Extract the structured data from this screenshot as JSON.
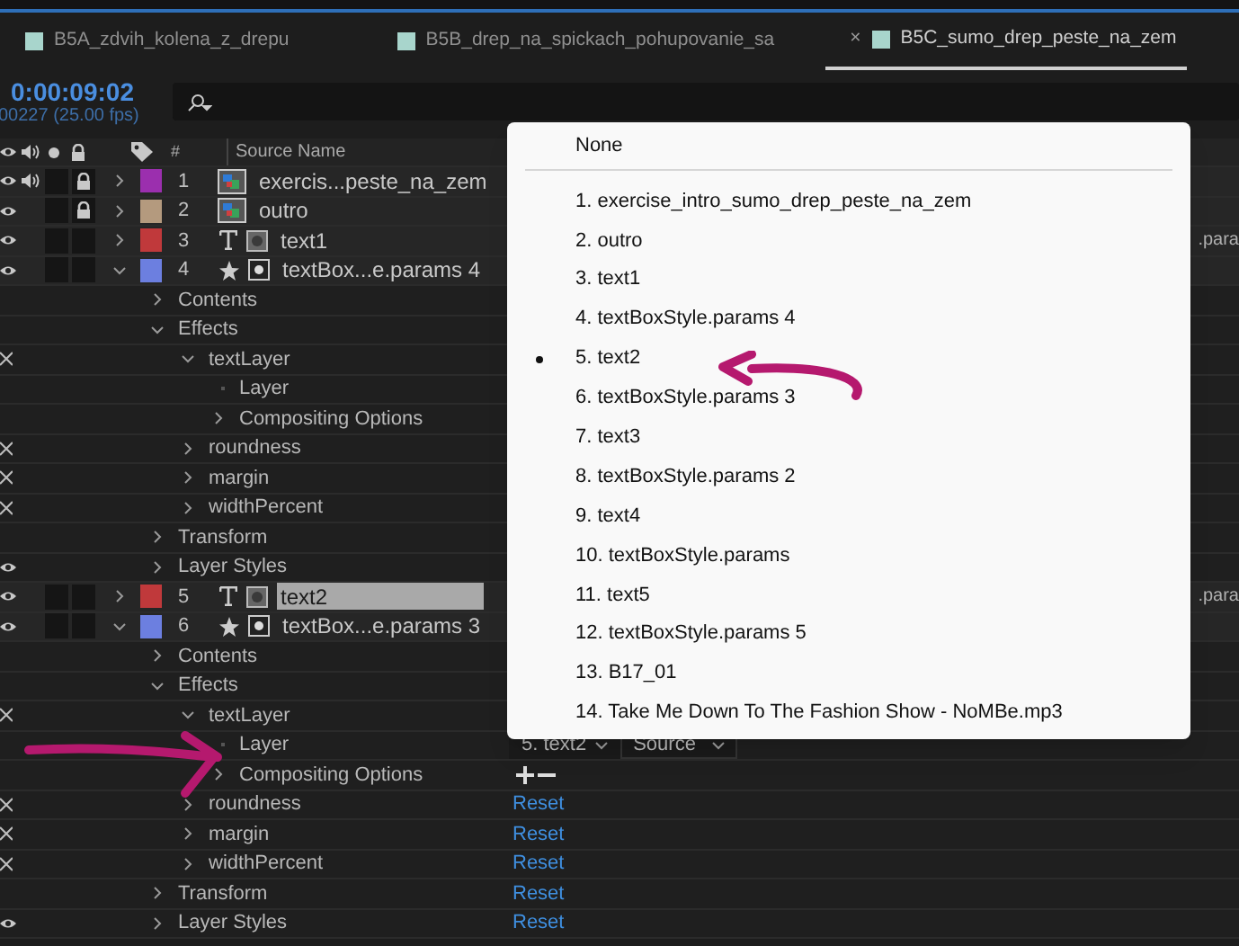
{
  "tabs": [
    {
      "label": "B5A_zdvih_kolena_z_drepu",
      "selected": false
    },
    {
      "label": "B5B_drep_na_spickach_pohupovanie_sa",
      "selected": false
    },
    {
      "label": "B5C_sumo_drep_peste_na_zem",
      "selected": true,
      "close": "×"
    }
  ],
  "timecode": "0:00:09:02",
  "frame_info": "00227 (25.00 fps)",
  "columns": {
    "number": "#",
    "source_name": "Source Name"
  },
  "layers": [
    {
      "number": "1",
      "name": "exercis...peste_na_zem",
      "color": "#9b2fae",
      "kind": "footage",
      "eye": true,
      "audio": true,
      "solo": false,
      "lock": true,
      "expanded": false,
      "selected": false
    },
    {
      "number": "2",
      "name": "outro",
      "color": "#b49a7e",
      "kind": "footage",
      "eye": true,
      "audio": false,
      "solo": false,
      "lock": true,
      "expanded": false,
      "selected": false
    },
    {
      "number": "3",
      "name": "text1",
      "color": "#c0393b",
      "kind": "text",
      "eye": true,
      "audio": false,
      "solo": false,
      "lock": false,
      "expanded": false,
      "selected": false,
      "parent": ".para"
    },
    {
      "number": "4",
      "name": "textBox...e.params 4",
      "color": "#6c7fe0",
      "kind": "shape",
      "eye": true,
      "audio": false,
      "solo": false,
      "lock": false,
      "expanded": true,
      "selected": false,
      "children": [
        {
          "label": "Contents",
          "expanded": false
        },
        {
          "label": "Effects",
          "expanded": true,
          "children": [
            {
              "label": "textLayer",
              "fx": true,
              "expanded": true,
              "children": [
                {
                  "label": "Layer"
                },
                {
                  "label": "Compositing Options",
                  "expanded": false
                }
              ]
            },
            {
              "label": "roundness",
              "fx": true,
              "expanded": false
            },
            {
              "label": "margin",
              "fx": true,
              "expanded": false
            },
            {
              "label": "widthPercent",
              "fx": true,
              "expanded": false
            }
          ]
        },
        {
          "label": "Transform",
          "expanded": false
        },
        {
          "label": "Layer Styles",
          "expanded": false,
          "eye": true
        }
      ]
    },
    {
      "number": "5",
      "name": "text2",
      "color": "#c0393b",
      "kind": "text",
      "eye": true,
      "audio": false,
      "solo": false,
      "lock": false,
      "expanded": false,
      "selected": true,
      "parent": ".para"
    },
    {
      "number": "6",
      "name": "textBox...e.params 3",
      "color": "#6c7fe0",
      "kind": "shape",
      "eye": true,
      "audio": false,
      "solo": false,
      "lock": false,
      "expanded": true,
      "selected": false,
      "children": [
        {
          "label": "Contents",
          "expanded": false
        },
        {
          "label": "Effects",
          "expanded": true,
          "children": [
            {
              "label": "textLayer",
              "fx": true,
              "expanded": true,
              "children": [
                {
                  "label": "Layer",
                  "value": {
                    "kind": "layer_select",
                    "layer": "5. text2",
                    "source": "Source"
                  }
                },
                {
                  "label": "Compositing Options",
                  "expanded": false,
                  "value": {
                    "kind": "plus_minus"
                  }
                }
              ]
            },
            {
              "label": "roundness",
              "fx": true,
              "expanded": false,
              "value": {
                "kind": "link",
                "text": "Reset"
              }
            },
            {
              "label": "margin",
              "fx": true,
              "expanded": false,
              "value": {
                "kind": "link",
                "text": "Reset"
              }
            },
            {
              "label": "widthPercent",
              "fx": true,
              "expanded": false,
              "value": {
                "kind": "link",
                "text": "Reset"
              }
            }
          ]
        },
        {
          "label": "Transform",
          "expanded": false,
          "value": {
            "kind": "link",
            "text": "Reset"
          }
        },
        {
          "label": "Layer Styles",
          "expanded": false,
          "eye": true,
          "value": {
            "kind": "link",
            "text": "Reset"
          }
        }
      ]
    }
  ],
  "menu": {
    "none": "None",
    "items": [
      {
        "label": "1. exercise_intro_sumo_drep_peste_na_zem",
        "selected": false
      },
      {
        "label": "2. outro",
        "selected": false
      },
      {
        "label": "3. text1",
        "selected": false
      },
      {
        "label": "4. textBoxStyle.params 4",
        "selected": false
      },
      {
        "label": "5. text2",
        "selected": true
      },
      {
        "label": "6. textBoxStyle.params 3",
        "selected": false
      },
      {
        "label": "7. text3",
        "selected": false
      },
      {
        "label": "8. textBoxStyle.params 2",
        "selected": false
      },
      {
        "label": "9. text4",
        "selected": false
      },
      {
        "label": "10. textBoxStyle.params",
        "selected": false
      },
      {
        "label": "11. text5",
        "selected": false
      },
      {
        "label": "12. textBoxStyle.params 5",
        "selected": false
      },
      {
        "label": "13. B17_01",
        "selected": false
      },
      {
        "label": "14. Take Me Down To The Fashion Show - NoMBe.mp3",
        "selected": false
      }
    ]
  }
}
